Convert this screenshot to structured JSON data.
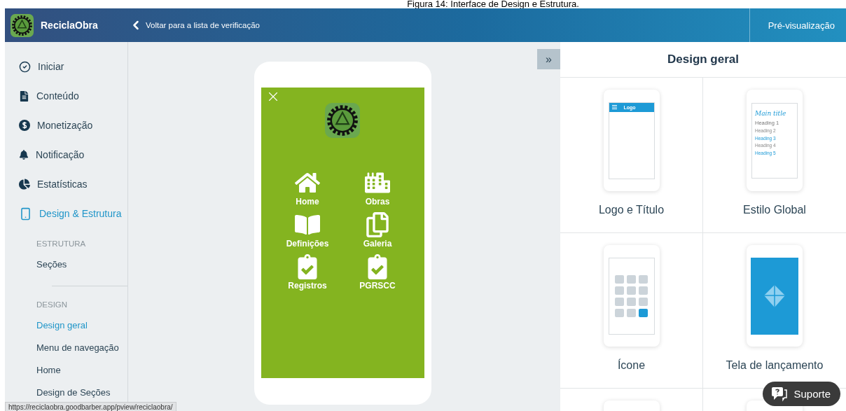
{
  "caption": "Figura 14: Interface de Design e Estrutura.",
  "app": {
    "name": "ReciclaObra"
  },
  "topbar": {
    "back_link": "Voltar para a lista de verificação",
    "preview_button": "Pré-visualização"
  },
  "sidebar": {
    "items": [
      {
        "label": "Iniciar",
        "selected": false
      },
      {
        "label": "Conteúdo",
        "selected": false
      },
      {
        "label": "Monetização",
        "selected": false
      },
      {
        "label": "Notificação",
        "selected": false
      },
      {
        "label": "Estatísticas",
        "selected": false
      },
      {
        "label": "Design & Estrutura",
        "selected": true
      }
    ],
    "groups": [
      {
        "heading": "ESTRUTURA",
        "items": [
          {
            "label": "Seções",
            "selected": false
          }
        ]
      },
      {
        "heading": "DESIGN",
        "items": [
          {
            "label": "Design geral",
            "selected": true
          },
          {
            "label": "Menu de navegação",
            "selected": false
          },
          {
            "label": "Home",
            "selected": false
          },
          {
            "label": "Design de Seções",
            "selected": false
          }
        ]
      }
    ]
  },
  "preview": {
    "menu": [
      {
        "label": "Home"
      },
      {
        "label": "Obras"
      },
      {
        "label": "Definições"
      },
      {
        "label": "Galeria"
      },
      {
        "label": "Registros"
      },
      {
        "label": "PGRSCC"
      }
    ]
  },
  "panel": {
    "collapse_button": "»",
    "title": "Design geral",
    "tiles": [
      {
        "kind": "logo",
        "label": "Logo e Título",
        "thumb_texts": [
          "Logo"
        ]
      },
      {
        "kind": "style",
        "label": "Estilo Global",
        "thumb_texts": [
          "Main title",
          "Heading 1",
          "Heading 2",
          "Heading 3",
          "Heading 4",
          "Heading 5"
        ]
      },
      {
        "kind": "icon",
        "label": "Ícone"
      },
      {
        "kind": "launch",
        "label": "Tela de lançamento"
      },
      {
        "kind": "blank"
      },
      {
        "kind": "blank"
      }
    ]
  },
  "support_button": "Suporte",
  "status_url": "https://reciclaobra.goodbarber.app/pview/reciclaobra/"
}
